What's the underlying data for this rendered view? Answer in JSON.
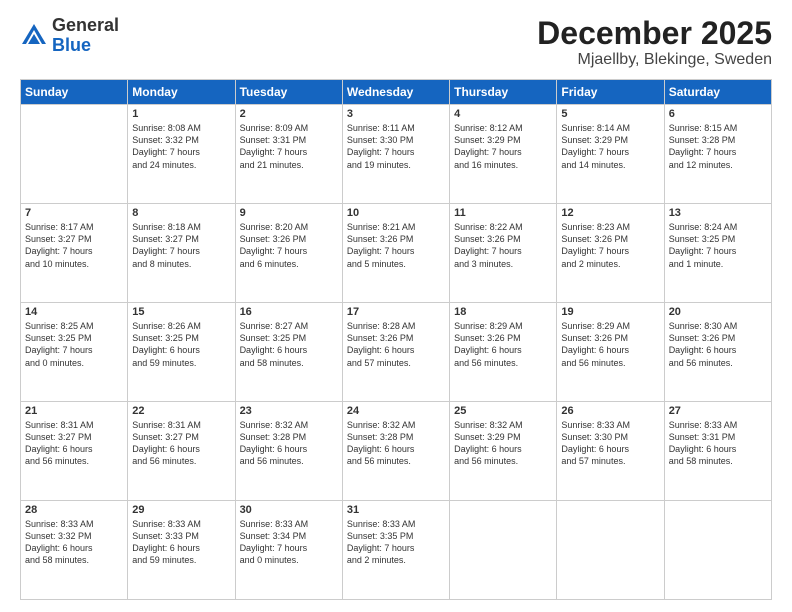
{
  "header": {
    "logo": {
      "line1": "General",
      "line2": "Blue"
    },
    "title": "December 2025",
    "location": "Mjaellby, Blekinge, Sweden"
  },
  "calendar": {
    "days_of_week": [
      "Sunday",
      "Monday",
      "Tuesday",
      "Wednesday",
      "Thursday",
      "Friday",
      "Saturday"
    ],
    "weeks": [
      [
        {
          "day": "",
          "info": ""
        },
        {
          "day": "1",
          "info": "Sunrise: 8:08 AM\nSunset: 3:32 PM\nDaylight: 7 hours\nand 24 minutes."
        },
        {
          "day": "2",
          "info": "Sunrise: 8:09 AM\nSunset: 3:31 PM\nDaylight: 7 hours\nand 21 minutes."
        },
        {
          "day": "3",
          "info": "Sunrise: 8:11 AM\nSunset: 3:30 PM\nDaylight: 7 hours\nand 19 minutes."
        },
        {
          "day": "4",
          "info": "Sunrise: 8:12 AM\nSunset: 3:29 PM\nDaylight: 7 hours\nand 16 minutes."
        },
        {
          "day": "5",
          "info": "Sunrise: 8:14 AM\nSunset: 3:29 PM\nDaylight: 7 hours\nand 14 minutes."
        },
        {
          "day": "6",
          "info": "Sunrise: 8:15 AM\nSunset: 3:28 PM\nDaylight: 7 hours\nand 12 minutes."
        }
      ],
      [
        {
          "day": "7",
          "info": "Sunrise: 8:17 AM\nSunset: 3:27 PM\nDaylight: 7 hours\nand 10 minutes."
        },
        {
          "day": "8",
          "info": "Sunrise: 8:18 AM\nSunset: 3:27 PM\nDaylight: 7 hours\nand 8 minutes."
        },
        {
          "day": "9",
          "info": "Sunrise: 8:20 AM\nSunset: 3:26 PM\nDaylight: 7 hours\nand 6 minutes."
        },
        {
          "day": "10",
          "info": "Sunrise: 8:21 AM\nSunset: 3:26 PM\nDaylight: 7 hours\nand 5 minutes."
        },
        {
          "day": "11",
          "info": "Sunrise: 8:22 AM\nSunset: 3:26 PM\nDaylight: 7 hours\nand 3 minutes."
        },
        {
          "day": "12",
          "info": "Sunrise: 8:23 AM\nSunset: 3:26 PM\nDaylight: 7 hours\nand 2 minutes."
        },
        {
          "day": "13",
          "info": "Sunrise: 8:24 AM\nSunset: 3:25 PM\nDaylight: 7 hours\nand 1 minute."
        }
      ],
      [
        {
          "day": "14",
          "info": "Sunrise: 8:25 AM\nSunset: 3:25 PM\nDaylight: 7 hours\nand 0 minutes."
        },
        {
          "day": "15",
          "info": "Sunrise: 8:26 AM\nSunset: 3:25 PM\nDaylight: 6 hours\nand 59 minutes."
        },
        {
          "day": "16",
          "info": "Sunrise: 8:27 AM\nSunset: 3:25 PM\nDaylight: 6 hours\nand 58 minutes."
        },
        {
          "day": "17",
          "info": "Sunrise: 8:28 AM\nSunset: 3:26 PM\nDaylight: 6 hours\nand 57 minutes."
        },
        {
          "day": "18",
          "info": "Sunrise: 8:29 AM\nSunset: 3:26 PM\nDaylight: 6 hours\nand 56 minutes."
        },
        {
          "day": "19",
          "info": "Sunrise: 8:29 AM\nSunset: 3:26 PM\nDaylight: 6 hours\nand 56 minutes."
        },
        {
          "day": "20",
          "info": "Sunrise: 8:30 AM\nSunset: 3:26 PM\nDaylight: 6 hours\nand 56 minutes."
        }
      ],
      [
        {
          "day": "21",
          "info": "Sunrise: 8:31 AM\nSunset: 3:27 PM\nDaylight: 6 hours\nand 56 minutes."
        },
        {
          "day": "22",
          "info": "Sunrise: 8:31 AM\nSunset: 3:27 PM\nDaylight: 6 hours\nand 56 minutes."
        },
        {
          "day": "23",
          "info": "Sunrise: 8:32 AM\nSunset: 3:28 PM\nDaylight: 6 hours\nand 56 minutes."
        },
        {
          "day": "24",
          "info": "Sunrise: 8:32 AM\nSunset: 3:28 PM\nDaylight: 6 hours\nand 56 minutes."
        },
        {
          "day": "25",
          "info": "Sunrise: 8:32 AM\nSunset: 3:29 PM\nDaylight: 6 hours\nand 56 minutes."
        },
        {
          "day": "26",
          "info": "Sunrise: 8:33 AM\nSunset: 3:30 PM\nDaylight: 6 hours\nand 57 minutes."
        },
        {
          "day": "27",
          "info": "Sunrise: 8:33 AM\nSunset: 3:31 PM\nDaylight: 6 hours\nand 58 minutes."
        }
      ],
      [
        {
          "day": "28",
          "info": "Sunrise: 8:33 AM\nSunset: 3:32 PM\nDaylight: 6 hours\nand 58 minutes."
        },
        {
          "day": "29",
          "info": "Sunrise: 8:33 AM\nSunset: 3:33 PM\nDaylight: 6 hours\nand 59 minutes."
        },
        {
          "day": "30",
          "info": "Sunrise: 8:33 AM\nSunset: 3:34 PM\nDaylight: 7 hours\nand 0 minutes."
        },
        {
          "day": "31",
          "info": "Sunrise: 8:33 AM\nSunset: 3:35 PM\nDaylight: 7 hours\nand 2 minutes."
        },
        {
          "day": "",
          "info": ""
        },
        {
          "day": "",
          "info": ""
        },
        {
          "day": "",
          "info": ""
        }
      ]
    ]
  }
}
